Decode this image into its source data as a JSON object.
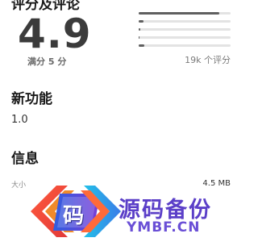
{
  "header": {
    "cut_title": "评分及评论"
  },
  "rating": {
    "score": "4.9",
    "out_of_label": "满分 5 分",
    "reviews_label": "19k 个评分",
    "distribution": [
      0.88,
      0.05,
      0.02,
      0.01,
      0.06
    ]
  },
  "whats_new": {
    "title": "新功能",
    "version": "1.0"
  },
  "info": {
    "title": "信息",
    "size_label": "大小",
    "size_value": "4.5 MB"
  },
  "watermark": {
    "logo_char": "码",
    "text": "源码备份",
    "domain": "YMBF.CN"
  },
  "colors": {
    "rating_text": "#3b3b3b",
    "bar_fill": "#5f5f5f",
    "bar_track": "#e3e3e3",
    "watermark": "#5b3fc8"
  }
}
